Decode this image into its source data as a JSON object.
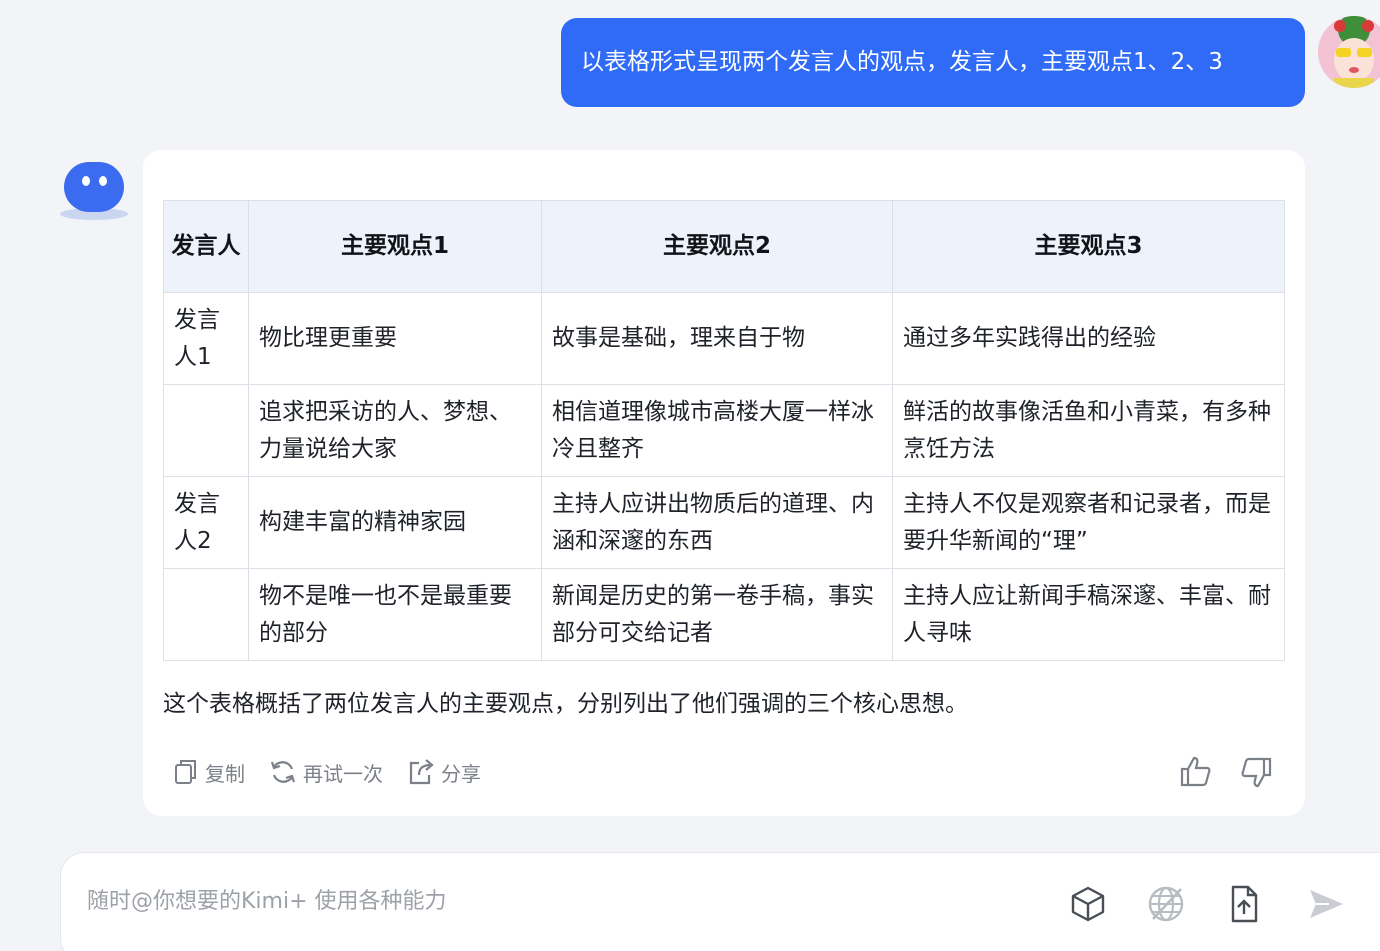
{
  "user_message": "以表格形式呈现两个发言人的观点，发言人，主要观点1、2、3",
  "table": {
    "headers": [
      "发言人",
      "主要观点1",
      "主要观点2",
      "主要观点3"
    ],
    "rows": [
      [
        "发言人1",
        "物比理更重要",
        "故事是基础，理来自于物",
        "通过多年实践得出的经验"
      ],
      [
        "",
        "追求把采访的人、梦想、力量说给大家",
        "相信道理像城市高楼大厦一样冰冷且整齐",
        "鲜活的故事像活鱼和小青菜，有多种烹饪方法"
      ],
      [
        "发言人2",
        "构建丰富的精神家园",
        "主持人应讲出物质后的道理、内涵和深邃的东西",
        "主持人不仅是观察者和记录者，而是要升华新闻的“理”"
      ],
      [
        "",
        "物不是唯一也不是最重要的部分",
        "新闻是历史的第一卷手稿，事实部分可交给记者",
        "主持人应让新闻手稿深邃、丰富、耐人寻味"
      ]
    ]
  },
  "summary": "这个表格概括了两位发言人的主要观点，分别列出了他们强调的三个核心思想。",
  "actions": {
    "copy": "复制",
    "retry": "再试一次",
    "share": "分享"
  },
  "input": {
    "placeholder": "随时@你想要的Kimi+ 使用各种能力"
  },
  "colors": {
    "accent": "#2f6bf6",
    "background": "#f2f4f8",
    "card": "#ffffff",
    "table_header": "#eef2fb",
    "icon_gray": "#7c8089"
  },
  "icons": [
    "copy-icon",
    "refresh-icon",
    "share-icon",
    "thumbs-up-icon",
    "thumbs-down-icon",
    "cube-icon",
    "web-search-off-icon",
    "upload-file-icon",
    "send-icon"
  ]
}
